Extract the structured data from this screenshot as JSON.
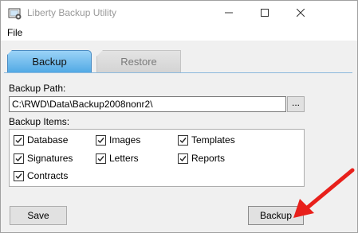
{
  "window": {
    "title": "Liberty Backup Utility",
    "controls": {
      "minimize": "minimize-icon",
      "maximize": "maximize-icon",
      "close": "close-icon"
    }
  },
  "menu": {
    "file": "File"
  },
  "tabs": [
    {
      "label": "Backup",
      "active": true
    },
    {
      "label": "Restore",
      "active": false
    }
  ],
  "backup_path": {
    "label": "Backup Path:",
    "value": "C:\\RWD\\Data\\Backup2008nonr2\\",
    "browse_label": "..."
  },
  "backup_items": {
    "label": "Backup Items:",
    "items": [
      {
        "label": "Database",
        "checked": true
      },
      {
        "label": "Images",
        "checked": true
      },
      {
        "label": "Templates",
        "checked": true
      },
      {
        "label": "Signatures",
        "checked": true
      },
      {
        "label": "Letters",
        "checked": true
      },
      {
        "label": "Reports",
        "checked": true
      },
      {
        "label": "Contracts",
        "checked": true
      }
    ]
  },
  "buttons": {
    "save": "Save",
    "backup": "Backup"
  },
  "colors": {
    "active_tab": "#4fa8e4",
    "annotation_arrow": "#e8201b"
  }
}
